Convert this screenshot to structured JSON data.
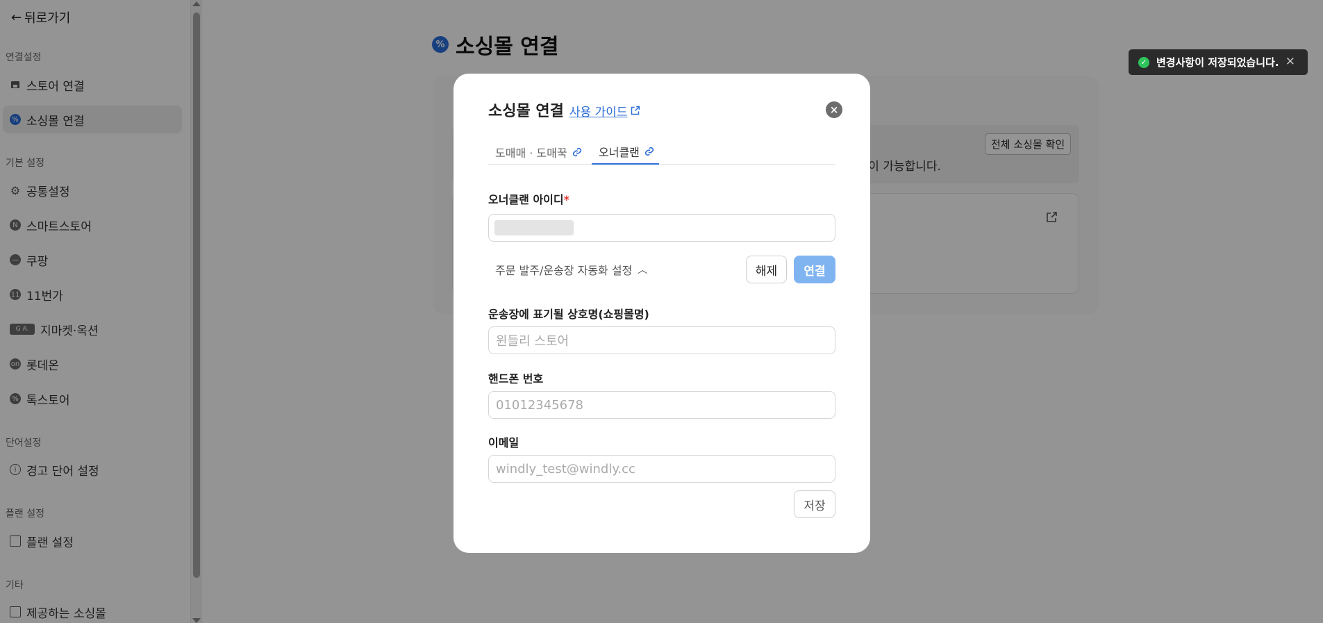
{
  "sidebar": {
    "back_label": "뒤로가기",
    "sections": {
      "connection": "연결설정",
      "basic": "기본 설정",
      "word": "단어설정",
      "plan": "플랜 설정",
      "etc": "기타"
    },
    "items": {
      "store_connect": "스토어 연결",
      "sourcing_connect": "소싱몰 연결",
      "common": "공통설정",
      "smartstore": "스마트스토어",
      "coupang": "쿠팡",
      "st11": "11번가",
      "gmarket": "지마켓·옥션",
      "lotteon": "롯데온",
      "toss": "톡스토어",
      "warning_words": "경고 단어 설정",
      "plan_settings": "플랜 설정",
      "provided_malls": "제공하는 소싱몰"
    },
    "icons": {
      "11st_text": "11",
      "gmarket_text": "G A."
    }
  },
  "page": {
    "title": "소싱몰 연결",
    "notice_text": "점)이 가능합니다.",
    "all_button": "전체 소싱몰 확인"
  },
  "modal": {
    "title": "소싱몰 연결",
    "guide_link": "사용 가이드",
    "tabs": [
      "도매매 · 도매꾹",
      "오너클랜"
    ],
    "id_label": "오너클랜 아이디",
    "required_mark": "*",
    "auto_label": "주문 발주/운송장 자동화 설정",
    "unlink_button": "해제",
    "link_button": "연결",
    "shop_name_label": "운송장에 표기될 상호명(쇼핑몰명)",
    "shop_name_placeholder": "윈들리 스토어",
    "phone_label": "핸드폰 번호",
    "phone_placeholder": "01012345678",
    "email_label": "이메일",
    "email_placeholder": "windly_test@windly.cc",
    "save_button": "저장"
  },
  "toast": {
    "message": "변경사항이 저장되었습니다."
  },
  "colors": {
    "accent": "#2f6fd8",
    "link_button": "#7fb4f1",
    "toast_bg": "#2b2b2b",
    "success": "#2ec35b"
  }
}
